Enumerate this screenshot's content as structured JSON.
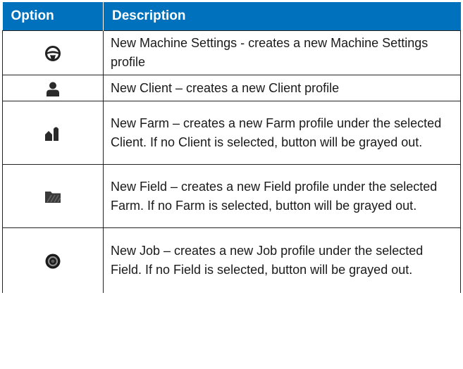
{
  "table": {
    "headers": {
      "option": "Option",
      "description": "Description"
    },
    "rows": [
      {
        "icon": "steering-wheel-icon",
        "description": "New Machine Settings - creates a new Machine Settings profile"
      },
      {
        "icon": "person-icon",
        "description": "New Client – creates a new Client profile"
      },
      {
        "icon": "farm-barn-silo-icon",
        "description": "New Farm – creates a new Farm profile under the selected Client. If no Client is selected, button will be grayed out."
      },
      {
        "icon": "field-folder-icon",
        "description": "New Field – creates a new Field profile under the selected Farm. If no Farm is selected, button will be grayed out."
      },
      {
        "icon": "job-disc-icon",
        "description": "New Job – creates a new Job profile under the selected Field. If no Field is selected, button will be grayed out."
      }
    ]
  }
}
